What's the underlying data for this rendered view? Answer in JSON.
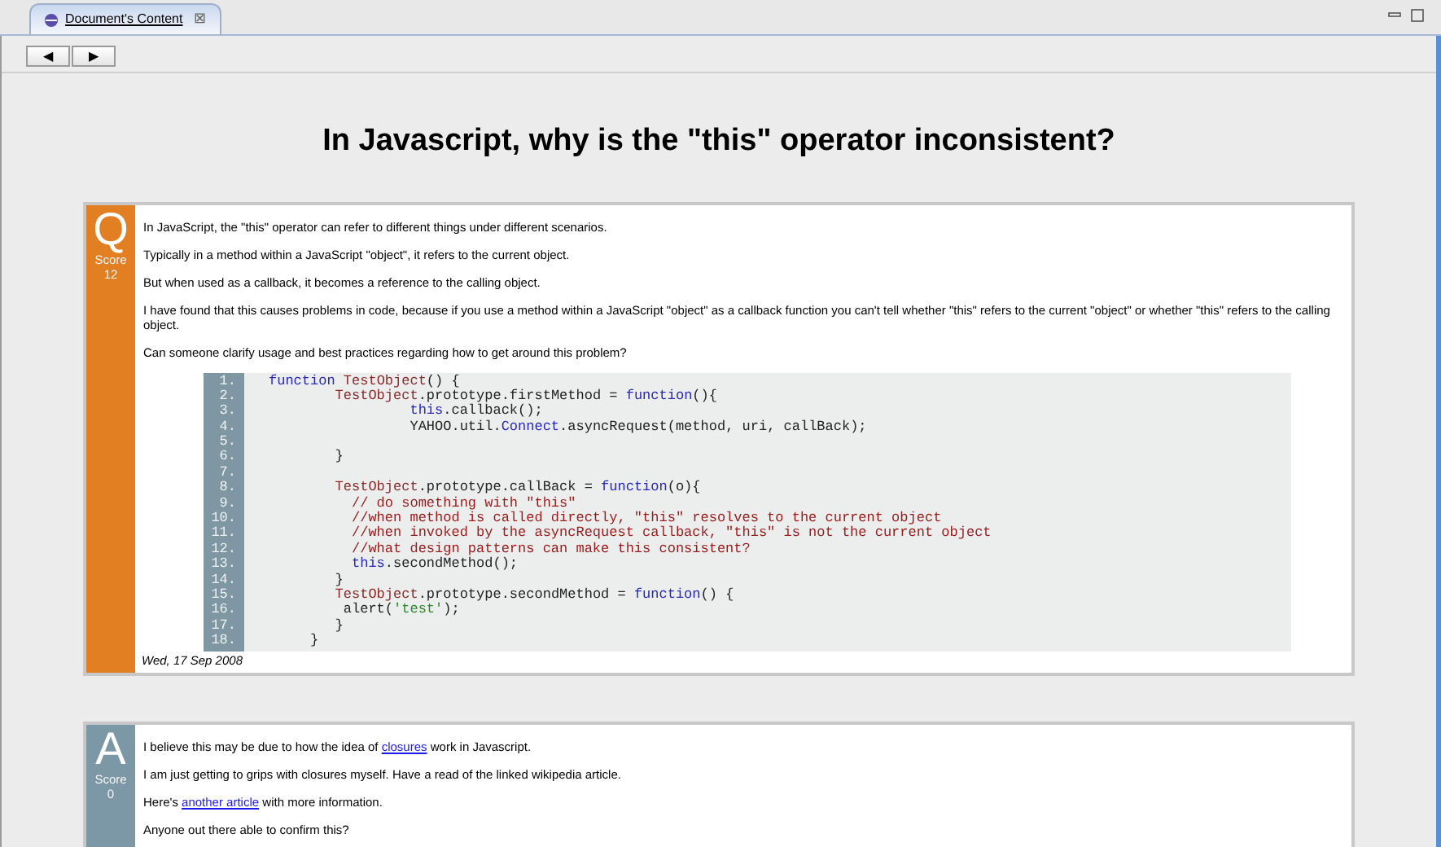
{
  "tab": {
    "label": "Document's Content",
    "close": "⊠",
    "selected": true
  },
  "toolbar": {
    "back": "◀",
    "forward": "▶"
  },
  "title": "In Javascript, why is the \"this\" operator inconsistent?",
  "posts": [
    {
      "kind": "question",
      "letter": "Q",
      "score_label": "Score",
      "score": "12",
      "paragraphs": [
        [
          {
            "text": "In JavaScript, the \"this\" operator can refer to different things under different scenarios."
          }
        ],
        [
          {
            "text": "Typically in a method within a JavaScript \"object\", it refers to the current object."
          }
        ],
        [
          {
            "text": "But when used as a callback, it becomes a reference to the calling object."
          }
        ],
        [
          {
            "text": "I have found that this causes problems in code, because if you use a method within a JavaScript \"object\" as a callback function you can't tell whether \"this\" refers to the current \"object\" or whether \"this\" refers to the calling object."
          }
        ],
        [
          {
            "text": "Can someone clarify usage and best practices regarding how to get around this problem?"
          }
        ]
      ],
      "code": [
        {
          "number": "1.",
          "tokens": [
            {
              "text": "function",
              "kind": "keyword"
            },
            {
              "text": " TestObject",
              "kind": "name"
            },
            {
              "text": "() {",
              "kind": "plain"
            }
          ]
        },
        {
          "number": "2.",
          "tokens": [
            {
              "text": "        TestObject",
              "kind": "name"
            },
            {
              "text": ".prototype.firstMethod = ",
              "kind": "plain"
            },
            {
              "text": "function",
              "kind": "keyword"
            },
            {
              "text": "(){",
              "kind": "plain"
            }
          ]
        },
        {
          "number": "3.",
          "tokens": [
            {
              "text": "                 this",
              "kind": "keyword"
            },
            {
              "text": ".callback();",
              "kind": "plain"
            }
          ]
        },
        {
          "number": "4.",
          "tokens": [
            {
              "text": "                 YAHOO.util.",
              "kind": "plain"
            },
            {
              "text": "Connect",
              "kind": "keyword"
            },
            {
              "text": ".asyncRequest(method, uri, callBack);",
              "kind": "plain"
            }
          ]
        },
        {
          "number": "5."
        },
        {
          "number": "6.",
          "tokens": [
            {
              "text": "        }",
              "kind": "plain"
            }
          ]
        },
        {
          "number": "7."
        },
        {
          "number": "8.",
          "tokens": [
            {
              "text": "        TestObject",
              "kind": "name"
            },
            {
              "text": ".prototype.callBack = ",
              "kind": "plain"
            },
            {
              "text": "function",
              "kind": "keyword"
            },
            {
              "text": "(o){",
              "kind": "plain"
            }
          ]
        },
        {
          "number": "9.",
          "tokens": [
            {
              "text": "          // do something with \"this\"",
              "kind": "comment"
            }
          ]
        },
        {
          "number": "10.",
          "tokens": [
            {
              "text": "          //when method is called directly, \"this\" resolves to the current object",
              "kind": "comment"
            }
          ]
        },
        {
          "number": "11.",
          "tokens": [
            {
              "text": "          //when invoked by the asyncRequest callback, \"this\" is not the current object",
              "kind": "comment"
            }
          ]
        },
        {
          "number": "12.",
          "tokens": [
            {
              "text": "          //what design patterns can make this consistent?",
              "kind": "comment"
            }
          ]
        },
        {
          "number": "13.",
          "tokens": [
            {
              "text": "          this",
              "kind": "keyword"
            },
            {
              "text": ".secondMethod();",
              "kind": "plain"
            }
          ]
        },
        {
          "number": "14.",
          "tokens": [
            {
              "text": "        }",
              "kind": "plain"
            }
          ]
        },
        {
          "number": "15.",
          "tokens": [
            {
              "text": "        TestObject",
              "kind": "name"
            },
            {
              "text": ".prototype.secondMethod = ",
              "kind": "plain"
            },
            {
              "text": "function",
              "kind": "keyword"
            },
            {
              "text": "() {",
              "kind": "plain"
            }
          ]
        },
        {
          "number": "16.",
          "tokens": [
            {
              "text": "         alert(",
              "kind": "plain"
            },
            {
              "text": "'test'",
              "kind": "string"
            },
            {
              "text": ");",
              "kind": "plain"
            }
          ]
        },
        {
          "number": "17.",
          "tokens": [
            {
              "text": "        }",
              "kind": "plain"
            }
          ]
        },
        {
          "number": "18.",
          "tokens": [
            {
              "text": "     }",
              "kind": "plain"
            }
          ]
        }
      ],
      "date": "Wed, 17 Sep 2008"
    },
    {
      "kind": "answer",
      "letter": "A",
      "score_label": "Score",
      "score": "0",
      "paragraphs": [
        [
          {
            "text": "I believe this may be due to how the idea of "
          },
          {
            "text": "closures",
            "link": true
          },
          {
            "text": " work in Javascript."
          }
        ],
        [
          {
            "text": "I am just getting to grips with closures myself. Have a read of the linked wikipedia article."
          }
        ],
        [
          {
            "text": "Here's "
          },
          {
            "text": "another article",
            "link": true
          },
          {
            "text": " with more information."
          }
        ],
        [
          {
            "text": "Anyone out there able to confirm this?"
          }
        ]
      ]
    }
  ]
}
